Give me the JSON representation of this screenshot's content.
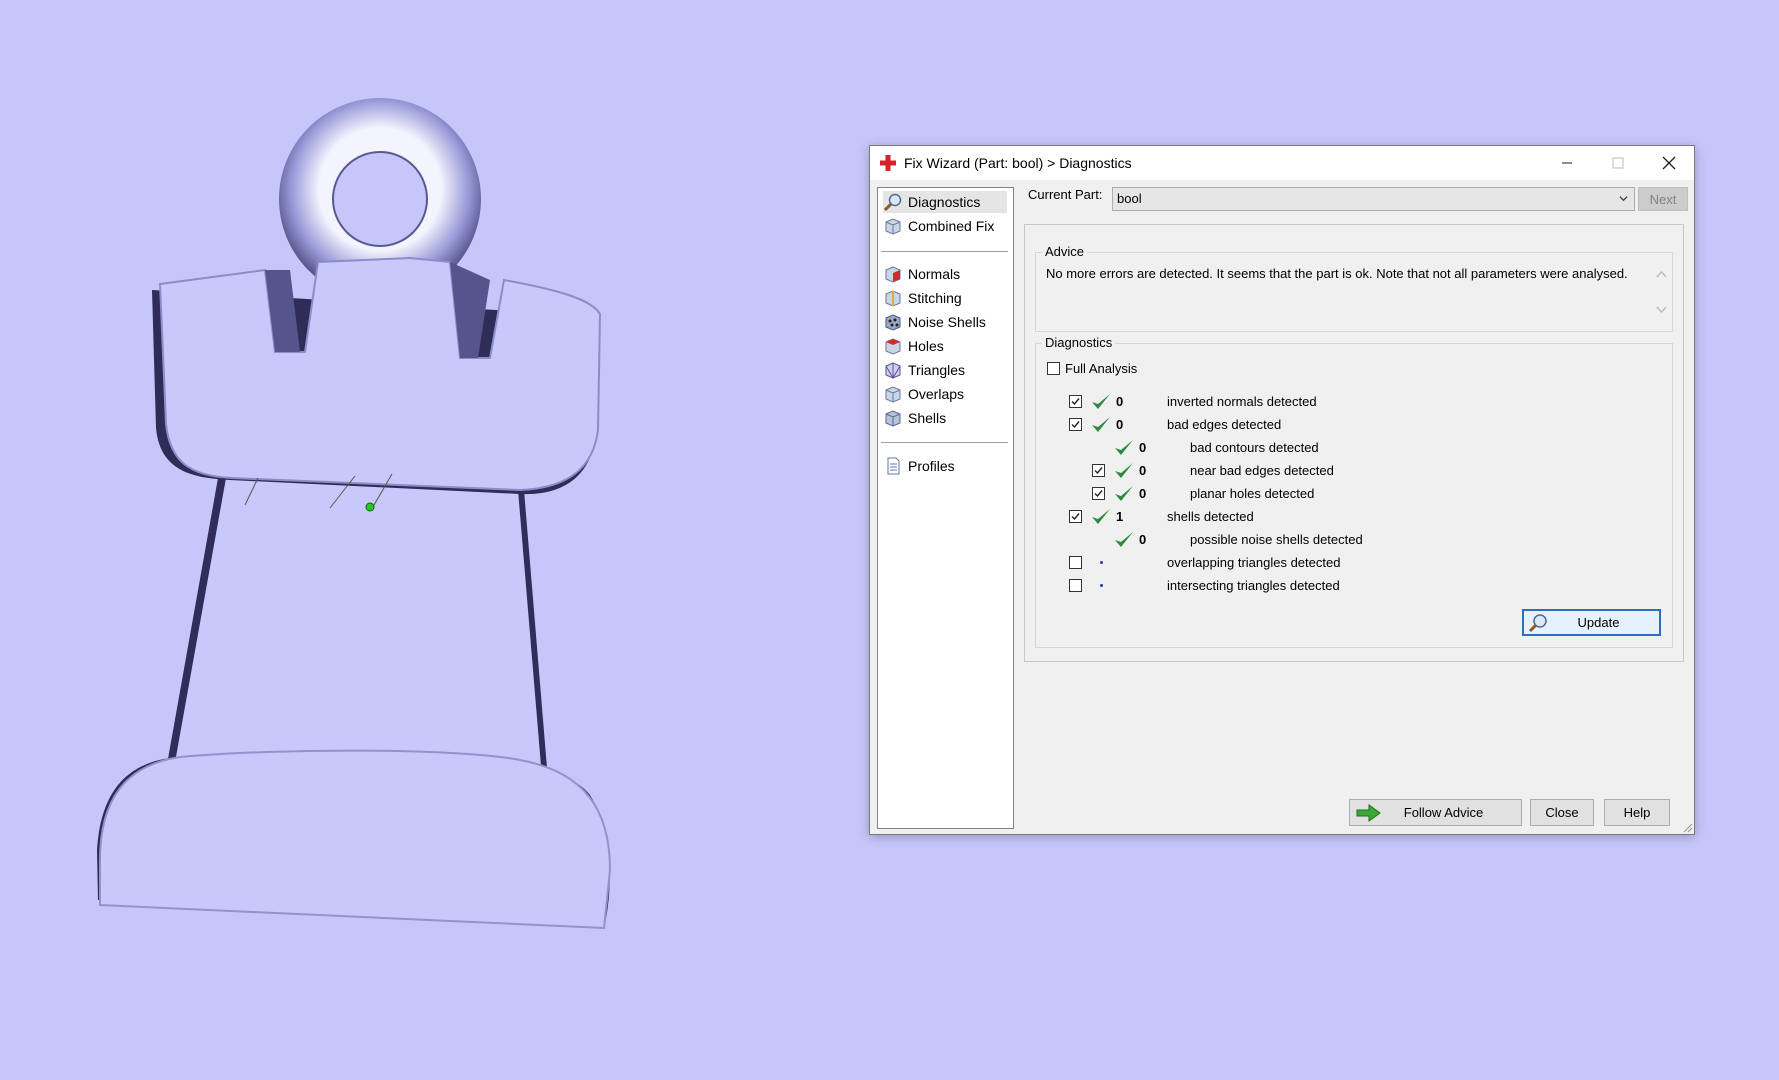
{
  "dialog": {
    "title": "Fix Wizard (Part: bool) > Diagnostics",
    "current_part_label": "Current Part:",
    "current_part_value": "bool",
    "next_label": "Next",
    "follow_advice_label": "Follow Advice",
    "close_label": "Close",
    "help_label": "Help",
    "update_label": "Update"
  },
  "nav": {
    "top": [
      {
        "label": "Diagnostics",
        "icon": "magnifier-icon",
        "selected": true
      },
      {
        "label": "Combined Fix",
        "icon": "cube-icon"
      }
    ],
    "tools": [
      {
        "label": "Normals",
        "icon": "normals-cube-icon"
      },
      {
        "label": "Stitching",
        "icon": "stitching-cube-icon"
      },
      {
        "label": "Noise Shells",
        "icon": "noise-shells-icon"
      },
      {
        "label": "Holes",
        "icon": "holes-cube-icon"
      },
      {
        "label": "Triangles",
        "icon": "triangles-cube-icon"
      },
      {
        "label": "Overlaps",
        "icon": "overlaps-cube-icon"
      },
      {
        "label": "Shells",
        "icon": "shells-cube-icon"
      }
    ],
    "bottom": [
      {
        "label": "Profiles",
        "icon": "document-icon"
      }
    ]
  },
  "advice": {
    "title": "Advice",
    "text": "No more errors are detected. It seems that the part is ok. Note that not all parameters were analysed."
  },
  "diagnostics": {
    "title": "Diagnostics",
    "full_analysis_label": "Full Analysis",
    "full_analysis_checked": false,
    "rows": [
      {
        "checkbox": true,
        "checked": true,
        "status": "ok",
        "count": "0",
        "label": "inverted normals detected",
        "indent": 0
      },
      {
        "checkbox": true,
        "checked": true,
        "status": "ok",
        "count": "0",
        "label": "bad edges detected",
        "indent": 0
      },
      {
        "checkbox": false,
        "checked": false,
        "status": "ok",
        "count": "0",
        "label": "bad contours detected",
        "indent": 1
      },
      {
        "checkbox": true,
        "checked": true,
        "status": "ok",
        "count": "0",
        "label": "near bad edges detected",
        "indent": 1
      },
      {
        "checkbox": true,
        "checked": true,
        "status": "ok",
        "count": "0",
        "label": "planar holes detected",
        "indent": 1
      },
      {
        "checkbox": true,
        "checked": true,
        "status": "ok",
        "count": "1",
        "label": "shells detected",
        "indent": 0
      },
      {
        "checkbox": false,
        "checked": false,
        "status": "ok",
        "count": "0",
        "label": "possible noise shells detected",
        "indent": 1
      },
      {
        "checkbox": true,
        "checked": false,
        "status": "pending",
        "count": "",
        "label": "overlapping triangles detected",
        "indent": 0
      },
      {
        "checkbox": true,
        "checked": false,
        "status": "pending",
        "count": "",
        "label": "intersecting triangles detected",
        "indent": 0
      }
    ]
  },
  "colors": {
    "background": "#c7c6fb",
    "model_fill": "#c9c8fa",
    "model_shade": "#3b3a66",
    "check_green": "#2e8b3e",
    "accent_red": "#d8232a"
  }
}
